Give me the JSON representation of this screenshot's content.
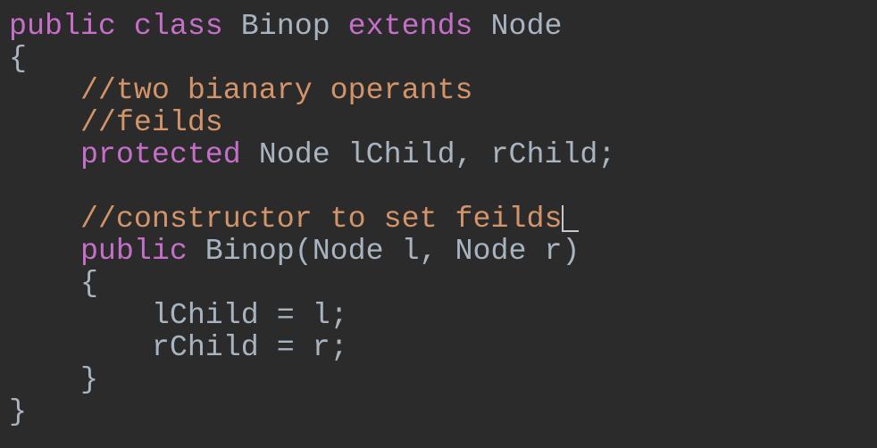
{
  "editor": {
    "theme_colors": {
      "background": "#2b2b2b",
      "keyword": "#c66fc9",
      "comment": "#d4946a",
      "identifier": "#a8b4bf",
      "cursor": "#c8c8c8"
    },
    "lines": [
      {
        "indent": "",
        "tokens": [
          {
            "type": "kw",
            "text": "public"
          },
          {
            "type": "id",
            "text": " "
          },
          {
            "type": "kw",
            "text": "class"
          },
          {
            "type": "id",
            "text": " Binop "
          },
          {
            "type": "kw",
            "text": "extends"
          },
          {
            "type": "id",
            "text": " Node"
          }
        ]
      },
      {
        "indent": "",
        "tokens": [
          {
            "type": "id",
            "text": "{"
          }
        ]
      },
      {
        "indent": "    ",
        "tokens": [
          {
            "type": "cm",
            "text": "//two bianary operants"
          }
        ]
      },
      {
        "indent": "    ",
        "tokens": [
          {
            "type": "cm",
            "text": "//feilds"
          }
        ]
      },
      {
        "indent": "    ",
        "tokens": [
          {
            "type": "kw",
            "text": "protected"
          },
          {
            "type": "id",
            "text": " Node lChild, rChild;"
          }
        ]
      },
      {
        "indent": "",
        "tokens": []
      },
      {
        "indent": "    ",
        "tokens": [
          {
            "type": "cm",
            "text": "//constructor to set feilds"
          }
        ],
        "cursor": true
      },
      {
        "indent": "    ",
        "tokens": [
          {
            "type": "kw",
            "text": "public"
          },
          {
            "type": "id",
            "text": " Binop(Node l, Node r)"
          }
        ]
      },
      {
        "indent": "    ",
        "tokens": [
          {
            "type": "id",
            "text": "{"
          }
        ]
      },
      {
        "indent": "        ",
        "tokens": [
          {
            "type": "id",
            "text": "lChild = l;"
          }
        ]
      },
      {
        "indent": "        ",
        "tokens": [
          {
            "type": "id",
            "text": "rChild = r;"
          }
        ]
      },
      {
        "indent": "    ",
        "tokens": [
          {
            "type": "id",
            "text": "}"
          }
        ]
      },
      {
        "indent": "",
        "tokens": [
          {
            "type": "id",
            "text": "}"
          }
        ]
      }
    ]
  }
}
